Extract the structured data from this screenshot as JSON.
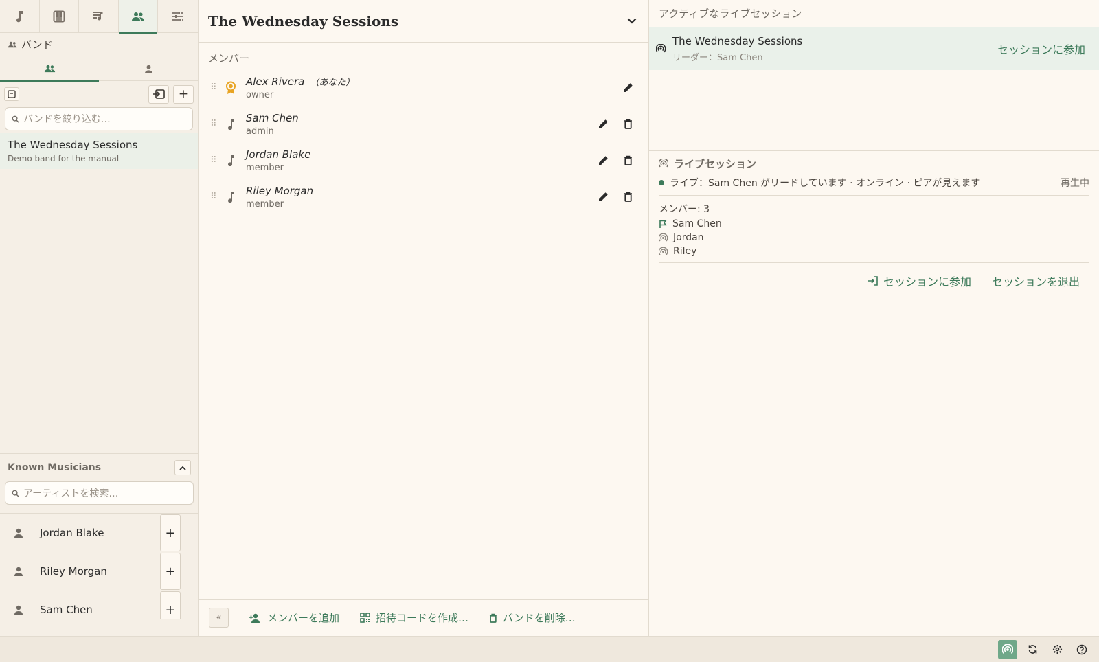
{
  "colors": {
    "accent": "#3d7a5a",
    "owner_badge": "#e8a423",
    "background": "#fdf8f1",
    "sidebar": "#f5efe6"
  },
  "top_tabs": [
    {
      "icon": "music-note-icon"
    },
    {
      "icon": "piano-icon"
    },
    {
      "icon": "playlist-icon"
    },
    {
      "icon": "group-icon",
      "active": true
    },
    {
      "icon": "sliders-icon"
    }
  ],
  "sidebar": {
    "section_label": "バンド",
    "sub_tabs": [
      {
        "icon": "group-icon",
        "active": true
      },
      {
        "icon": "person-icon"
      }
    ],
    "filter_placeholder": "バンドを絞り込む…",
    "bands": [
      {
        "name": "The Wednesday Sessions",
        "description": "Demo band for the manual"
      }
    ],
    "known_musicians": {
      "title": "Known Musicians",
      "search_placeholder": "アーティストを検索…",
      "items": [
        {
          "name": "Jordan Blake"
        },
        {
          "name": "Riley Morgan"
        },
        {
          "name": "Sam Chen"
        }
      ]
    }
  },
  "band": {
    "title": "The Wednesday Sessions",
    "members_label": "メンバー",
    "members": [
      {
        "name": "Alex Rivera",
        "you": "（あなた）",
        "role": "owner"
      },
      {
        "name": "Sam Chen",
        "role": "admin"
      },
      {
        "name": "Jordan Blake",
        "role": "member"
      },
      {
        "name": "Riley Morgan",
        "role": "member"
      }
    ],
    "footer": {
      "collapse_label": "«",
      "add_member": "メンバーを追加",
      "invite_code": "招待コードを作成…",
      "delete_band": "バンドを削除…"
    }
  },
  "live": {
    "active_header": "アクティブなライブセッション",
    "session": {
      "name": "The Wednesday Sessions",
      "leader": "リーダー：Sam Chen",
      "join": "セッションに参加"
    },
    "section_title": "ライブセッション",
    "status": "ライブ：Sam Chen がリードしています · オンライン · ピアが見えます",
    "playing": "再生中",
    "member_count": "メンバー: 3",
    "members": [
      {
        "name": "Sam Chen",
        "icon": "flag-icon"
      },
      {
        "name": "Jordan",
        "icon": "broadcast-icon"
      },
      {
        "name": "Riley",
        "icon": "broadcast-icon"
      }
    ],
    "join_btn": "セッションに参加",
    "leave_btn": "セッションを退出"
  },
  "statusbar": {
    "buttons": [
      "broadcast-icon",
      "sync-icon",
      "gear-icon",
      "help-icon"
    ]
  }
}
